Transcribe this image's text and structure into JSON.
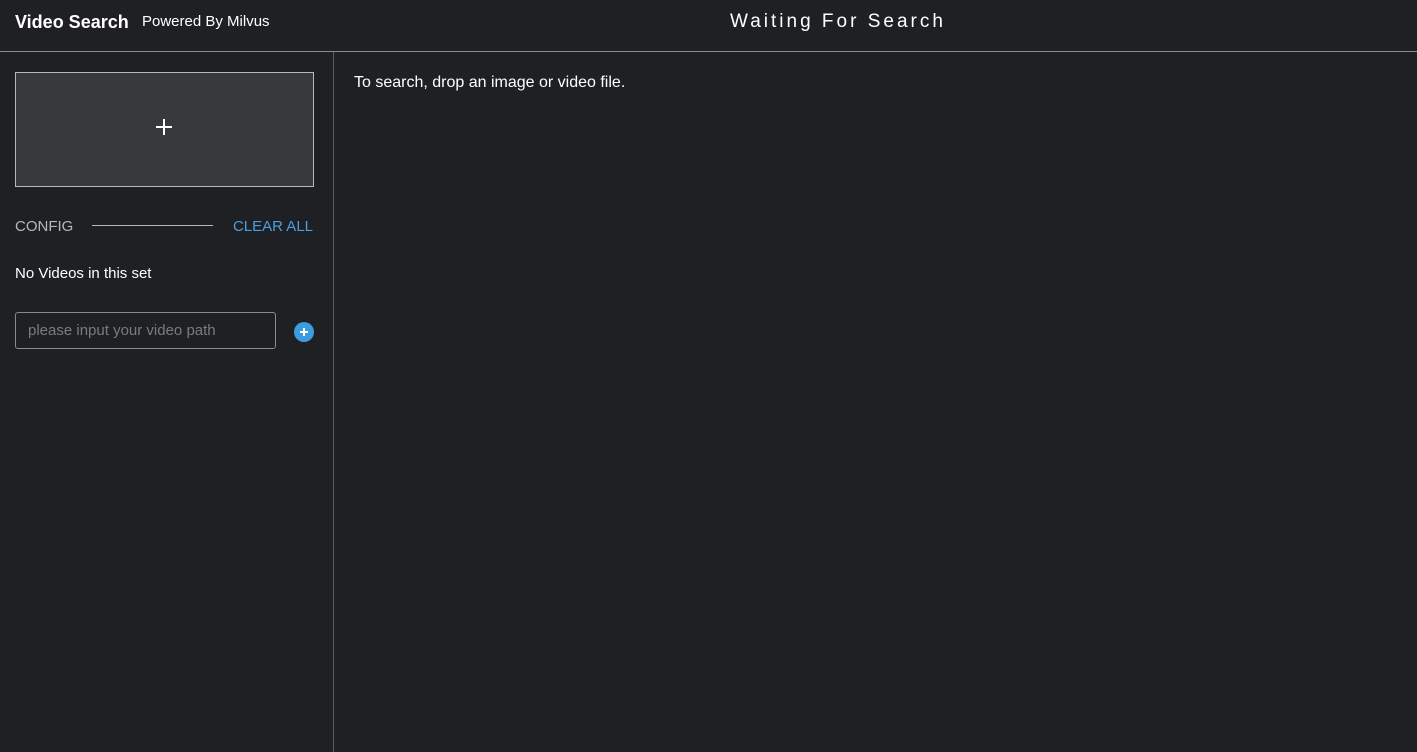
{
  "header": {
    "app_title": "Video Search",
    "powered_by": "Powered By Milvus",
    "status": "Waiting For Search"
  },
  "sidebar": {
    "upload_icon": "plus-icon",
    "config_label": "CONFIG",
    "clear_all_label": "CLEAR ALL",
    "empty_message": "No Videos in this set",
    "path_input": {
      "value": "",
      "placeholder": "please input your video path"
    },
    "add_icon": "add-circle-icon"
  },
  "main": {
    "hint": "To search, drop an image or video file."
  },
  "colors": {
    "background": "#1f2023",
    "accent": "#4a9fe3",
    "dropzone": "#38393c"
  }
}
